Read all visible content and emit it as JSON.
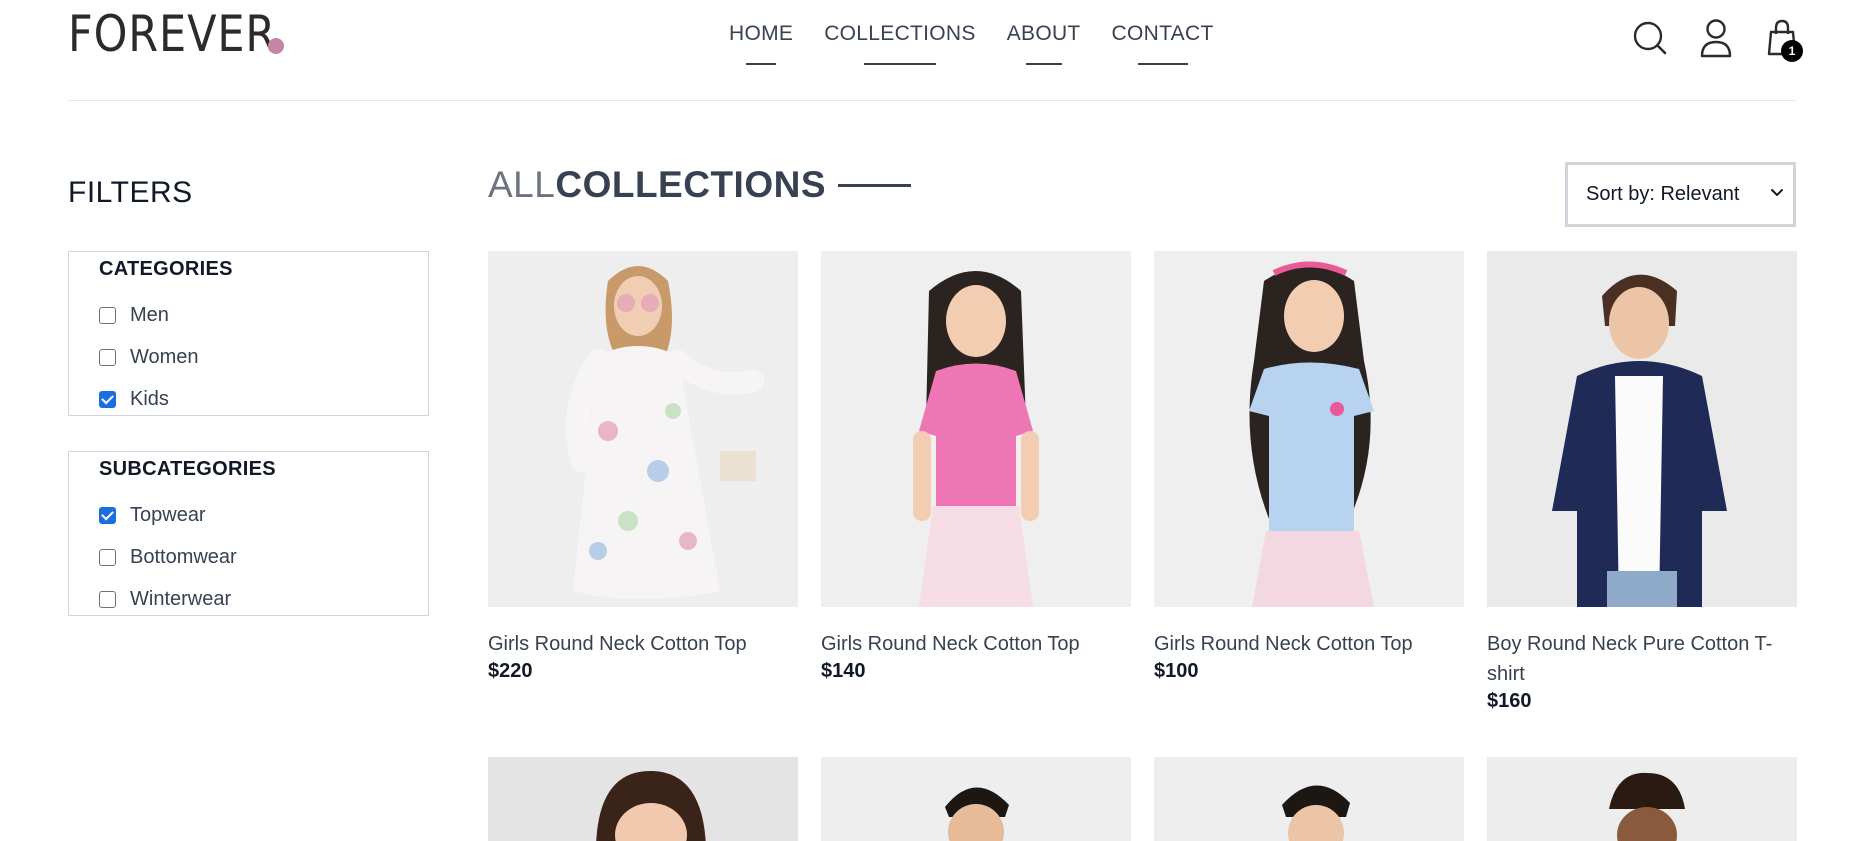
{
  "brand": {
    "logo_text": "FOREVER",
    "dot_color": "#c586a5"
  },
  "nav": {
    "items": [
      {
        "label": "HOME"
      },
      {
        "label": "COLLECTIONS"
      },
      {
        "label": "ABOUT"
      },
      {
        "label": "CONTACT"
      }
    ]
  },
  "header_icons": {
    "search": "search-icon",
    "profile": "user-icon",
    "cart": "shopping-bag-icon",
    "cart_count": "1"
  },
  "filters": {
    "title": "FILTERS",
    "categories": {
      "heading": "CATEGORIES",
      "options": [
        {
          "label": "Men",
          "checked": false
        },
        {
          "label": "Women",
          "checked": false
        },
        {
          "label": "Kids",
          "checked": true
        }
      ]
    },
    "subcategories": {
      "heading": "SUBCATEGORIES",
      "options": [
        {
          "label": "Topwear",
          "checked": true
        },
        {
          "label": "Bottomwear",
          "checked": false
        },
        {
          "label": "Winterwear",
          "checked": false
        }
      ]
    }
  },
  "collections": {
    "title_light": "ALL",
    "title_dark": "COLLECTIONS"
  },
  "sort": {
    "label": "Sort by: Relevant"
  },
  "products": [
    {
      "name": "Girls Round Neck Cotton Top",
      "price": "$220"
    },
    {
      "name": "Girls Round Neck Cotton Top",
      "price": "$140"
    },
    {
      "name": "Girls Round Neck Cotton Top",
      "price": "$100"
    },
    {
      "name": "Boy Round Neck Pure Cotton T-shirt",
      "price": "$160"
    }
  ],
  "colors": {
    "accent_check": "#1a6fe0",
    "text": "#374151",
    "border": "#d1d5db"
  }
}
